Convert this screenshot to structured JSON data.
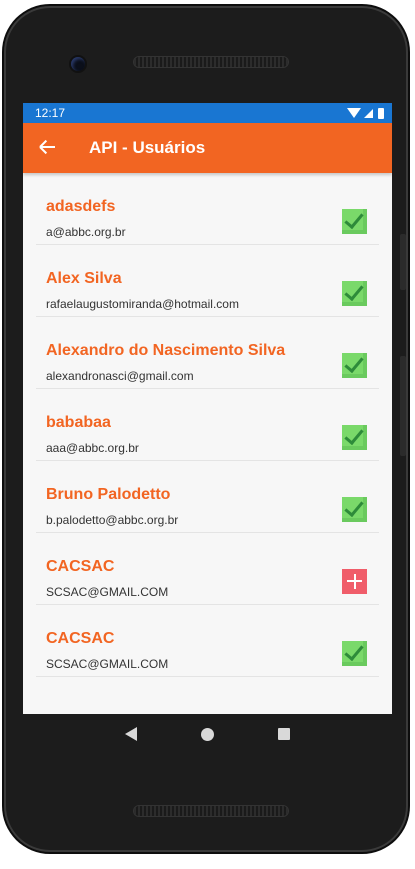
{
  "status_bar": {
    "time": "12:17"
  },
  "app_bar": {
    "title": "API - Usuários",
    "back_icon": "arrow-left-icon"
  },
  "users": [
    {
      "name": "adasdefs",
      "email": "a@abbc.org.br",
      "status": "active"
    },
    {
      "name": "Alex Silva",
      "email": "rafaelaugustomiranda@hotmail.com",
      "status": "active"
    },
    {
      "name": "Alexandro do Nascimento Silva",
      "email": "alexandronasci@gmail.com",
      "status": "active"
    },
    {
      "name": "bababaa",
      "email": "aaa@abbc.org.br",
      "status": "active"
    },
    {
      "name": "Bruno Palodetto",
      "email": "b.palodetto@abbc.org.br",
      "status": "active"
    },
    {
      "name": "CACSAC",
      "email": "SCSAC@GMAIL.COM",
      "status": "inactive"
    },
    {
      "name": "CACSAC",
      "email": "SCSAC@GMAIL.COM",
      "status": "active"
    }
  ],
  "colors": {
    "accent": "#f26522",
    "status_bar": "#1976d2",
    "active": "#7ad96a",
    "inactive": "#f05d6a"
  }
}
